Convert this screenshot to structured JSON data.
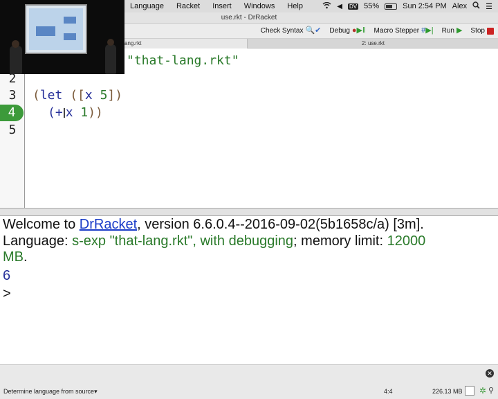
{
  "menubar": {
    "items": [
      "Language",
      "Racket",
      "Insert",
      "Windows",
      "Help"
    ],
    "dv": "DV",
    "battery": "55%",
    "clock": "Sun 2:54 PM",
    "user": "Alex"
  },
  "window": {
    "title": "use.rkt - DrRacket"
  },
  "toolbar": {
    "check_syntax": "Check Syntax",
    "debug": "Debug",
    "macro_stepper": "Macro Stepper",
    "run": "Run",
    "stop": "Stop"
  },
  "tabs": [
    {
      "label": "ang.rkt"
    },
    {
      "label": "2: use.rkt"
    }
  ],
  "editor": {
    "line_numbers": [
      "2",
      "3",
      "4",
      "5"
    ],
    "active_line": "4",
    "line1_string": "\"that-lang.rkt\"",
    "line3_open": "(",
    "line3_kw": "let",
    "line3_mid": " ([",
    "line3_var": "x",
    "line3_num": "5",
    "line3_close": "])",
    "line4_open": "(+",
    "line4_x": "x",
    "line4_num": "1",
    "line4_close": "))"
  },
  "repl": {
    "welcome_prefix": "Welcome to ",
    "welcome_link": "DrRacket",
    "welcome_suffix": ", version 6.6.0.4--2016-09-02(5b1658c/a) [3m].",
    "lang_prefix": "Language: ",
    "lang_value": "s-exp \"that-lang.rkt\", with debugging",
    "lang_mid": "; memory limit: ",
    "lang_limit": "12000",
    "lang_unit": "MB",
    "lang_end": ".",
    "result": "6",
    "prompt": ">"
  },
  "status": {
    "language_selector": "Determine language from source",
    "position": "4:4",
    "memory": "226.13 MB"
  },
  "icons": [
    "wifi-icon",
    "volume-icon",
    "battery-icon",
    "search-icon",
    "list-icon",
    "check-syntax-icon",
    "debug-icon",
    "macro-stepper-icon",
    "run-icon",
    "stop-icon",
    "close-icon",
    "bug-icon",
    "running-man-icon"
  ]
}
